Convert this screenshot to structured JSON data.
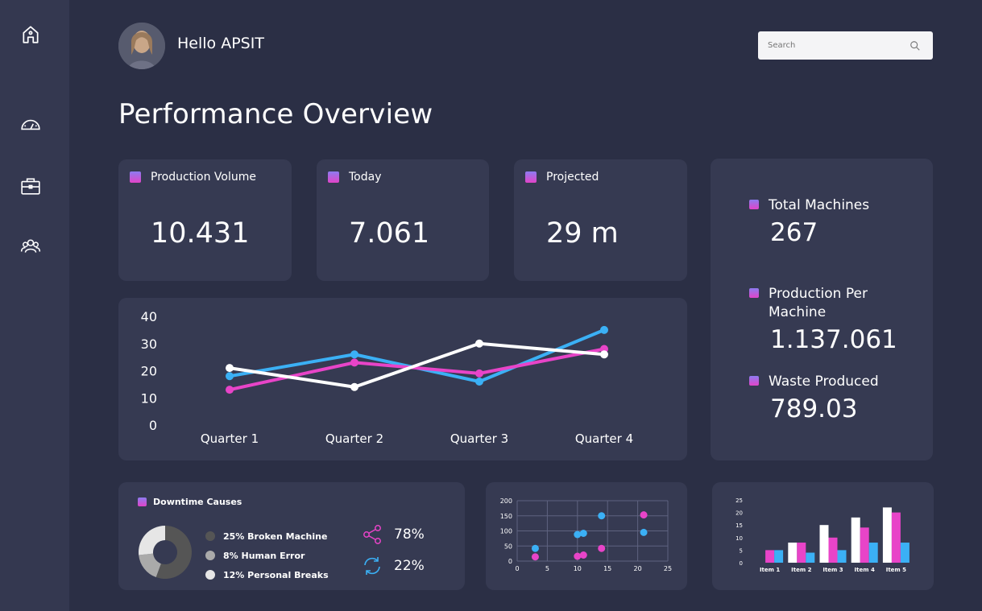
{
  "user": {
    "greeting": "Hello APSIT"
  },
  "search": {
    "placeholder": "Search"
  },
  "page": {
    "title": "Performance Overview"
  },
  "nav": [
    {
      "icon": "home-icon"
    },
    {
      "icon": "dashboard-gauge-icon"
    },
    {
      "icon": "briefcase-icon"
    },
    {
      "icon": "users-icon"
    }
  ],
  "stats": [
    {
      "label": "Production Volume",
      "value": "10.431"
    },
    {
      "label": "Today",
      "value": "7.061"
    },
    {
      "label": "Projected",
      "value": "29 m"
    }
  ],
  "side_stats": [
    {
      "label": "Total Machines",
      "value": "267"
    },
    {
      "label": "Production Per Machine",
      "value": "1.137.061"
    },
    {
      "label": "Waste Produced",
      "value": "789.03"
    }
  ],
  "downtime": {
    "title": "Downtime Causes",
    "items": [
      {
        "label": "25% Broken Machine",
        "color": "#555555"
      },
      {
        "label": "8% Human Error",
        "color": "#aaaaaa"
      },
      {
        "label": "12% Personal Breaks",
        "color": "#e6e6e6"
      }
    ],
    "metrics": [
      {
        "icon": "share-icon",
        "value": "78%"
      },
      {
        "icon": "sync-icon",
        "value": "22%"
      }
    ]
  },
  "colors": {
    "blue": "#3bb0f5",
    "pink": "#e844c8",
    "white": "#ffffff",
    "card": "#363a52",
    "bg": "#2b2f45"
  },
  "chart_data": [
    {
      "type": "line",
      "categories": [
        "Quarter 1",
        "Quarter 2",
        "Quarter 3",
        "Quarter 4"
      ],
      "yticks": [
        0,
        10,
        20,
        30,
        40
      ],
      "ylim": [
        0,
        40
      ],
      "series": [
        {
          "color": "#3bb0f5",
          "values": [
            18,
            26,
            16,
            35
          ]
        },
        {
          "color": "#e844c8",
          "values": [
            13,
            23,
            19,
            28
          ]
        },
        {
          "color": "#ffffff",
          "values": [
            21,
            14,
            30,
            26
          ]
        }
      ]
    },
    {
      "type": "scatter",
      "xlim": [
        0,
        25
      ],
      "ylim": [
        0,
        200
      ],
      "xticks": [
        0,
        5,
        10,
        15,
        20,
        25
      ],
      "yticks": [
        0,
        50,
        100,
        150,
        200
      ],
      "series": [
        {
          "color": "#3bb0f5",
          "points": [
            [
              3,
              42
            ],
            [
              10,
              88
            ],
            [
              11,
              92
            ],
            [
              14,
              150
            ],
            [
              21,
              95
            ]
          ]
        },
        {
          "color": "#e844c8",
          "points": [
            [
              3,
              14
            ],
            [
              10,
              16
            ],
            [
              11,
              20
            ],
            [
              14,
              42
            ],
            [
              21,
              153
            ]
          ]
        }
      ]
    },
    {
      "type": "bar",
      "categories": [
        "Item 1",
        "Item 2",
        "Item 3",
        "Item 4",
        "Item 5"
      ],
      "ylim": [
        0,
        25
      ],
      "yticks": [
        0,
        5,
        10,
        15,
        20,
        25
      ],
      "series": [
        {
          "color": "#ffffff",
          "values": [
            0,
            8,
            15,
            18,
            22
          ]
        },
        {
          "color": "#e844c8",
          "values": [
            5,
            8,
            10,
            14,
            20
          ]
        },
        {
          "color": "#3bb0f5",
          "values": [
            5,
            4,
            5,
            8,
            8
          ]
        }
      ]
    },
    {
      "type": "pie",
      "categories": [
        "25% Broken Machine",
        "8% Human Error",
        "12% Personal Breaks"
      ],
      "values": [
        25,
        8,
        12
      ],
      "colors": [
        "#555555",
        "#aaaaaa",
        "#e6e6e6"
      ]
    }
  ]
}
